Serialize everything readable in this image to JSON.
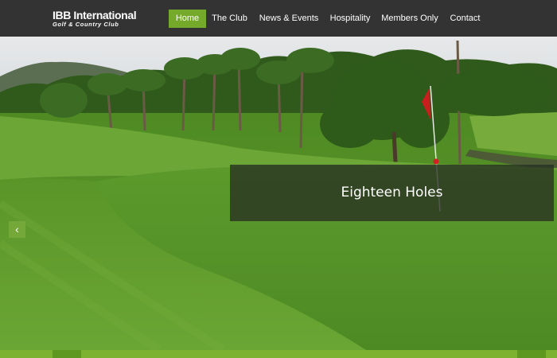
{
  "logo": {
    "title": "IBB International",
    "subtitle": "Golf & Country Club"
  },
  "nav": {
    "items": [
      {
        "label": "Home",
        "active": true
      },
      {
        "label": "The Club",
        "active": false
      },
      {
        "label": "News & Events",
        "active": false
      },
      {
        "label": "Hospitality",
        "active": false
      },
      {
        "label": "Members Only",
        "active": false
      },
      {
        "label": "Contact",
        "active": false
      }
    ]
  },
  "slider": {
    "caption": "Eighteen Holes",
    "prev_icon": "chevron-left-icon",
    "flag_color": "#c81e1e"
  },
  "colors": {
    "accent": "#74a92a",
    "header_bg": "#333333",
    "grass": "#5e9b2c"
  }
}
